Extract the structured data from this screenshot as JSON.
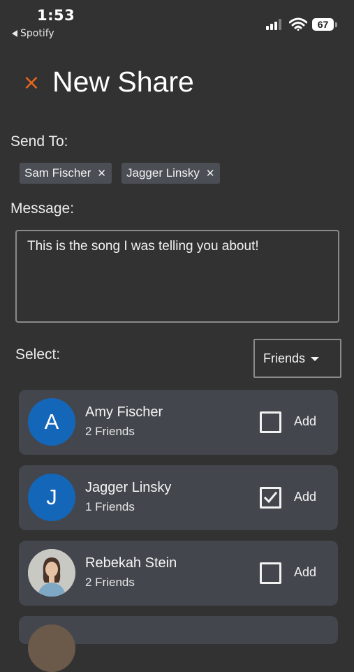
{
  "status_bar": {
    "time": "1:53",
    "back_app": "Spotify",
    "battery": "67"
  },
  "header": {
    "close_glyph": "×",
    "title": "New Share"
  },
  "send_to": {
    "label": "Send To:",
    "recipients": [
      {
        "name": "Sam Fischer",
        "remove_glyph": "✕"
      },
      {
        "name": "Jagger Linsky",
        "remove_glyph": "✕"
      }
    ]
  },
  "message": {
    "label": "Message:",
    "value": "This is the song I was telling you about!"
  },
  "select": {
    "label": "Select:",
    "value": "Friends"
  },
  "contacts": [
    {
      "initial": "A",
      "name": "Amy Fischer",
      "sub": "2 Friends",
      "checked": false,
      "add_label": "Add",
      "avatar": "initial"
    },
    {
      "initial": "J",
      "name": "Jagger Linsky",
      "sub": "1 Friends",
      "checked": true,
      "add_label": "Add",
      "avatar": "initial"
    },
    {
      "initial": "",
      "name": "Rebekah Stein",
      "sub": "2 Friends",
      "checked": false,
      "add_label": "Add",
      "avatar": "photo"
    }
  ],
  "colors": {
    "background": "#323232",
    "accent_close": "#e4661f",
    "avatar_blue": "#1466b8",
    "card": "#43474d",
    "chip": "#4b4f55"
  },
  "icons": {
    "close": "close-icon",
    "back": "back-triangle-icon",
    "signal": "cellular-signal-icon",
    "wifi": "wifi-icon",
    "battery": "battery-icon",
    "dropdown": "caret-down-icon",
    "check": "checkmark-icon"
  }
}
